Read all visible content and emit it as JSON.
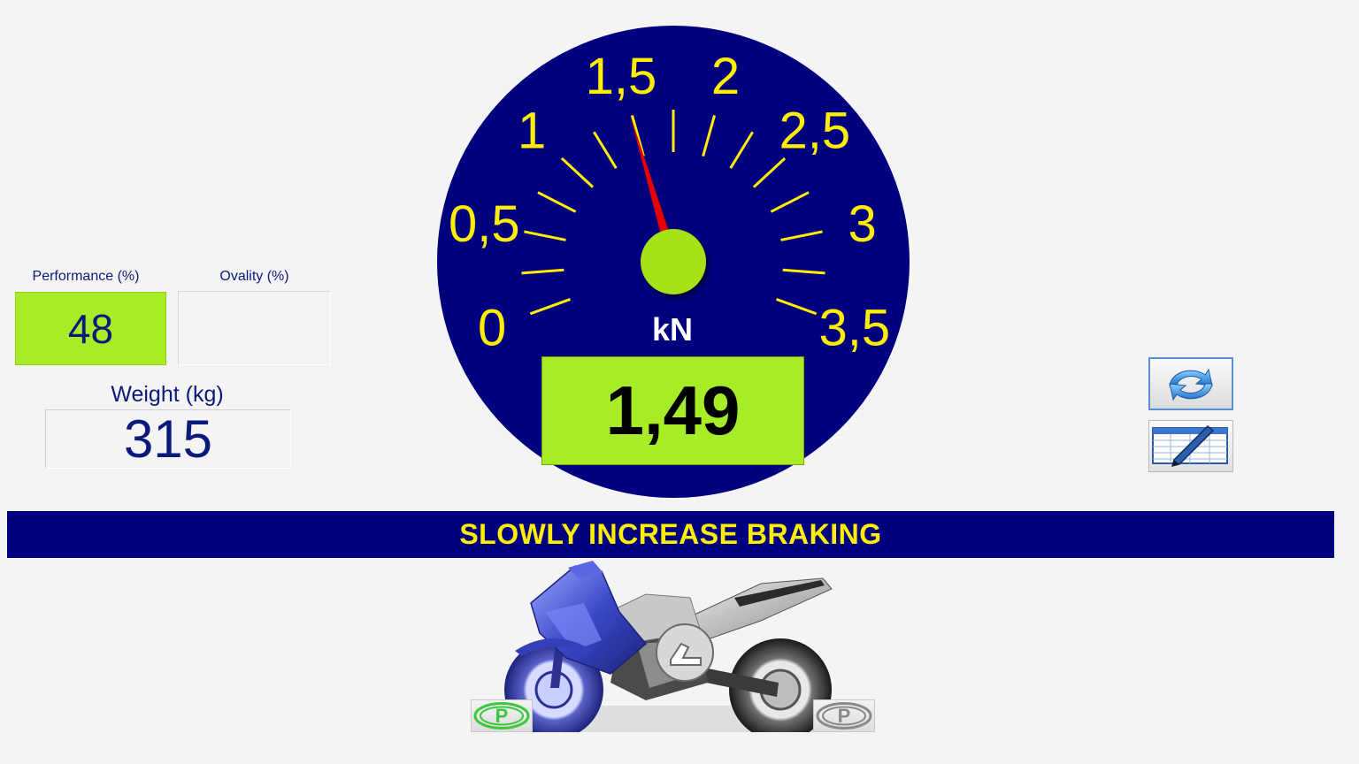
{
  "colors": {
    "dial_fill": "#00007f",
    "scale_yellow": "#ffee00",
    "needle_red": "#e80000",
    "hub_green": "#a6e317",
    "indicator_green": "#a7ec26",
    "bar_navy": "#00007f",
    "text_navy": "#0b1a7a",
    "park_active": "#3cc83c",
    "park_inactive": "#8a8a8a"
  },
  "performance": {
    "label": "Performance (%)",
    "value": "48"
  },
  "ovality": {
    "label": "Ovality (%)",
    "value": ""
  },
  "weight": {
    "label": "Weight (kg)",
    "value": "315"
  },
  "gauge": {
    "unit": "kN",
    "reading": "1,49",
    "reading_value": 1.49,
    "scale_min": 0,
    "scale_max": 3.5,
    "scale_labels": [
      "0",
      "0,5",
      "1",
      "1,5",
      "2",
      "2,5",
      "3",
      "3,5"
    ]
  },
  "message": "SLOWLY INCREASE BRAKING",
  "toolbar": {
    "refresh_icon": "refresh-arrows-icon",
    "edit_icon": "edit-spreadsheet-icon"
  },
  "vehicle": {
    "image": "motorcycle-icon",
    "front_parking_indicator": {
      "glyph": "P",
      "state": "active"
    },
    "rear_parking_indicator": {
      "glyph": "P",
      "state": "inactive"
    }
  }
}
